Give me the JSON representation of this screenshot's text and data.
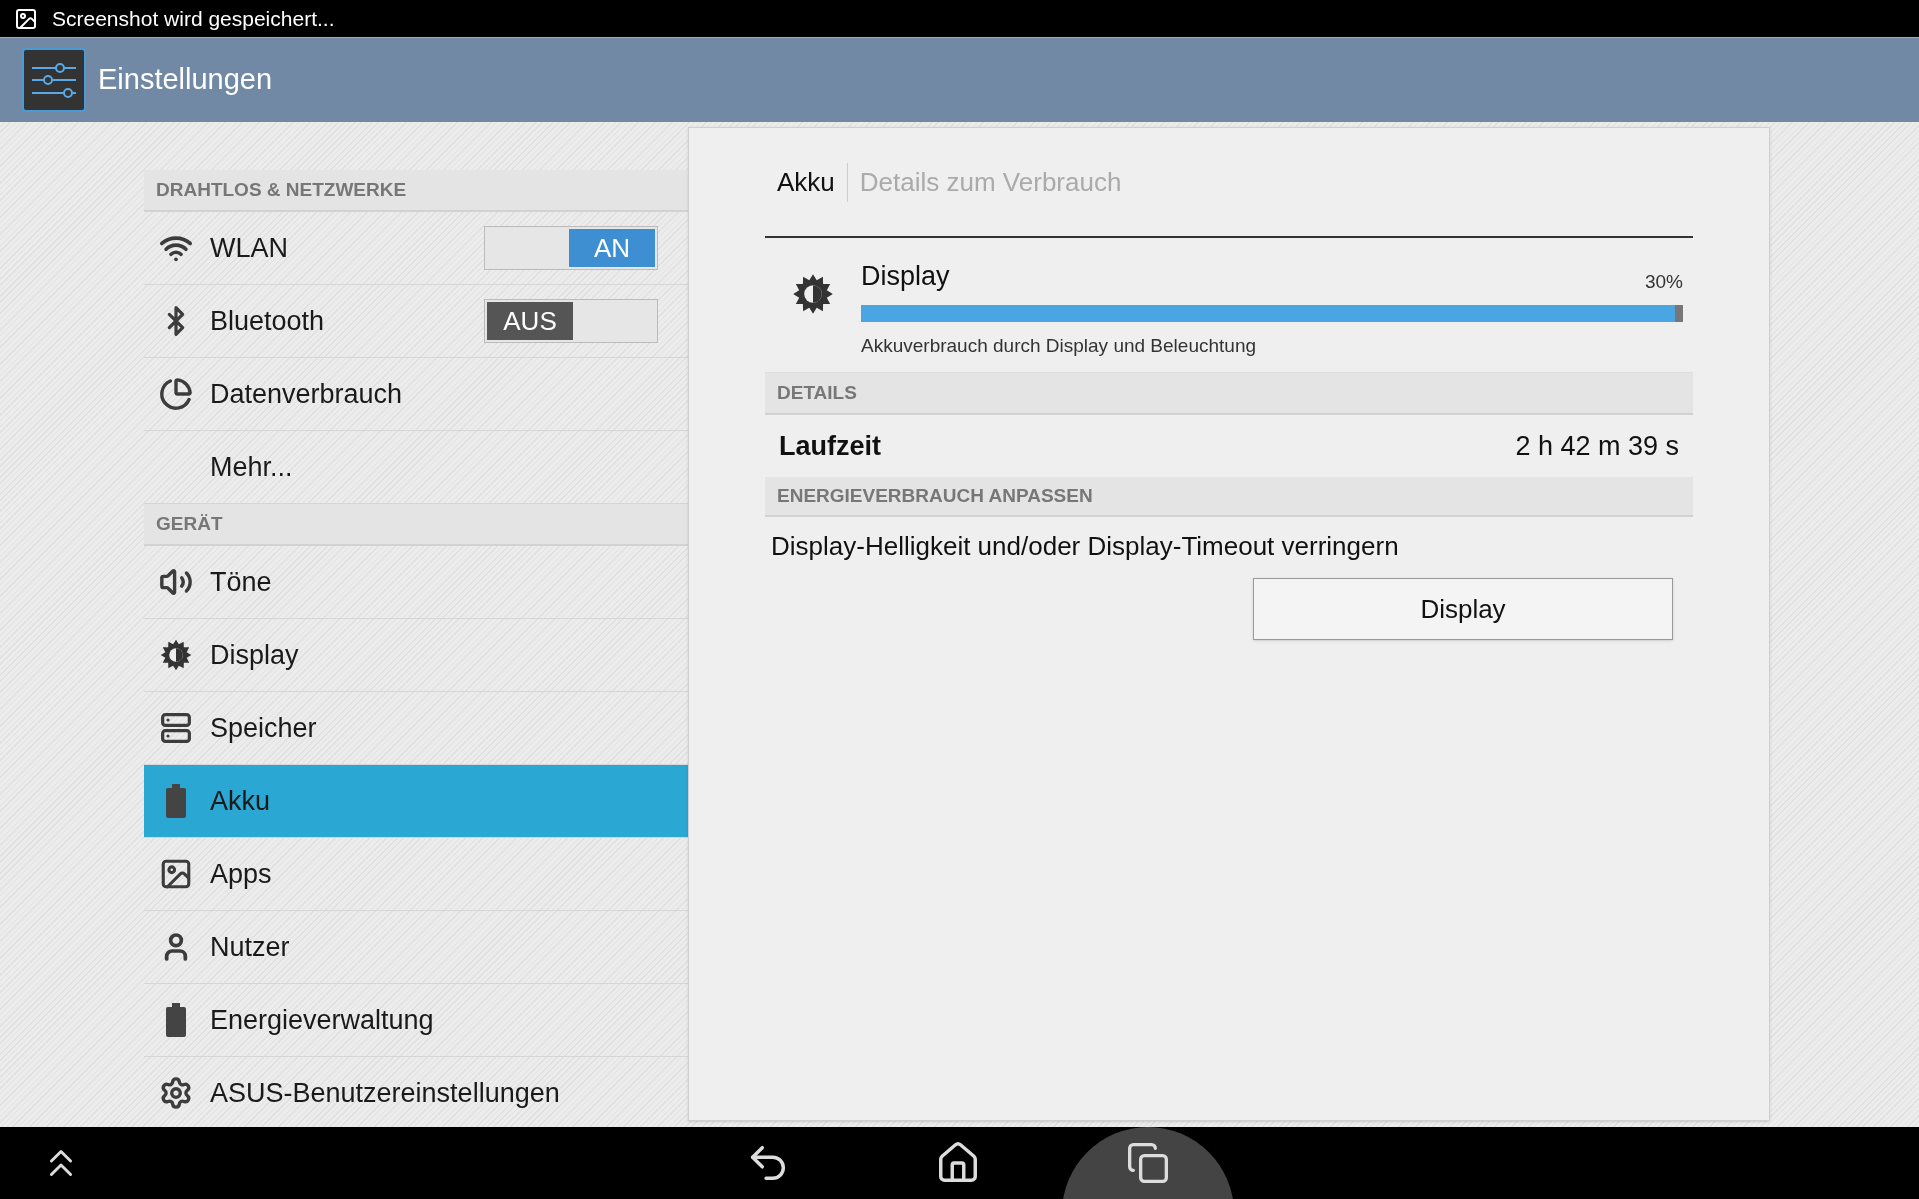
{
  "status_bar": {
    "notification": "Screenshot wird gespeichert..."
  },
  "action_bar": {
    "title": "Einstellungen"
  },
  "sidebar": {
    "sections": [
      {
        "header": "DRAHTLOS & NETZWERKE",
        "items": [
          {
            "label": "WLAN",
            "selected": false,
            "toggle": {
              "on": true,
              "label": "AN"
            }
          },
          {
            "label": "Bluetooth",
            "selected": false,
            "toggle": {
              "on": false,
              "label": "AUS"
            }
          },
          {
            "label": "Datenverbrauch",
            "selected": false
          },
          {
            "label": "Mehr...",
            "selected": false
          }
        ]
      },
      {
        "header": "GERÄT",
        "items": [
          {
            "label": "Töne",
            "selected": false
          },
          {
            "label": "Display",
            "selected": false
          },
          {
            "label": "Speicher",
            "selected": false
          },
          {
            "label": "Akku",
            "selected": true
          },
          {
            "label": "Apps",
            "selected": false
          },
          {
            "label": "Nutzer",
            "selected": false
          },
          {
            "label": "Energieverwaltung",
            "selected": false
          },
          {
            "label": "ASUS-Benutzereinstellungen",
            "selected": false
          }
        ]
      }
    ]
  },
  "detail": {
    "tabs": [
      {
        "label": "Akku",
        "selected": true
      },
      {
        "label": "Details zum Verbrauch",
        "selected": false
      }
    ],
    "usage": {
      "title": "Display",
      "reading": "30%",
      "level": 1,
      "description": "Akkuverbrauch durch Display und Beleuchtung"
    },
    "details": {
      "header": "DETAILS",
      "rows": [
        {
          "label": "Laufzeit",
          "value": "2 h 42 m 39 s"
        }
      ]
    },
    "adjust": {
      "header": "ENERGIEVERBRAUCH ANPASSEN",
      "text": "Display-Helligkeit und/oder Display-Timeout verringern",
      "button": "Display"
    }
  }
}
